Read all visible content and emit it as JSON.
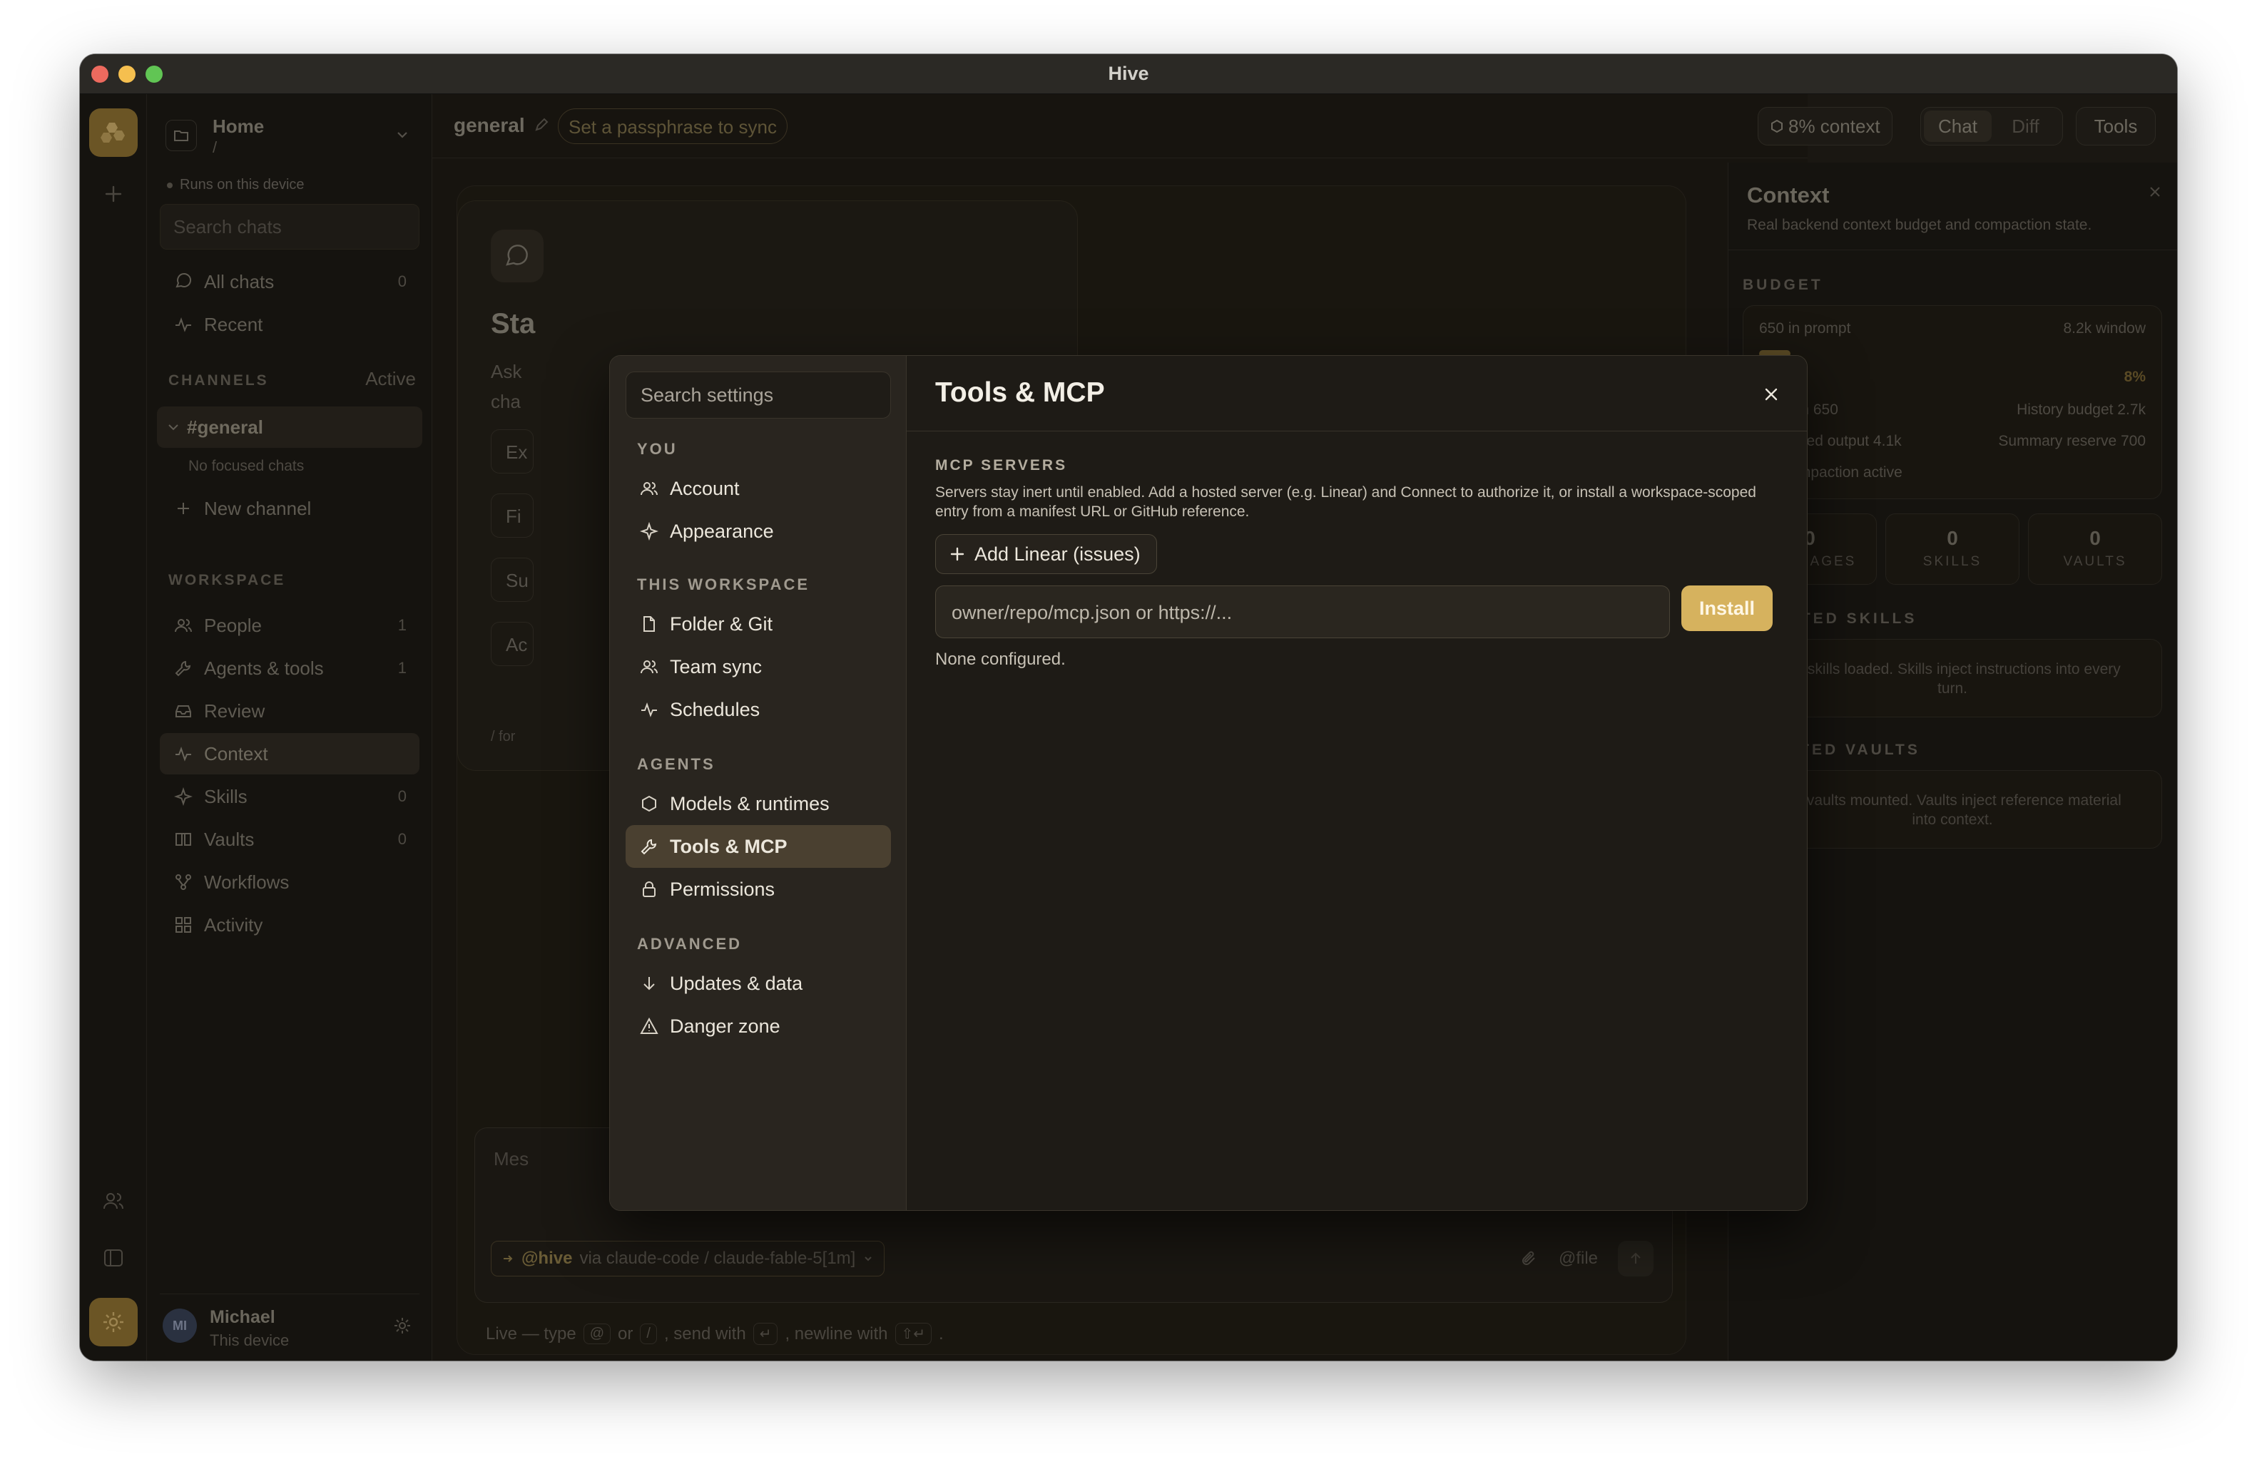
{
  "window": {
    "title": "Hive"
  },
  "sidebar": {
    "workspace_name": "Home",
    "workspace_path": "/",
    "device_note": "Runs on this device",
    "search_placeholder": "Search chats",
    "items_top": [
      {
        "label": "All chats",
        "count": "0",
        "icon": "chat-bubble-icon"
      },
      {
        "label": "Recent",
        "count": "",
        "icon": "activity-icon"
      }
    ],
    "channels_label": "CHANNELS",
    "channels_status": "Active",
    "channel_active": "#general",
    "channel_sub": "No focused chats",
    "new_channel": "New channel",
    "workspace_label": "WORKSPACE",
    "workspace_items": [
      {
        "label": "People",
        "count": "1",
        "icon": "people-icon"
      },
      {
        "label": "Agents & tools",
        "count": "1",
        "icon": "wrench-icon"
      },
      {
        "label": "Review",
        "count": "",
        "icon": "inbox-icon"
      },
      {
        "label": "Context",
        "count": "",
        "icon": "activity-icon"
      },
      {
        "label": "Skills",
        "count": "0",
        "icon": "sparkle-icon"
      },
      {
        "label": "Vaults",
        "count": "0",
        "icon": "book-icon"
      },
      {
        "label": "Workflows",
        "count": "",
        "icon": "workflow-icon"
      },
      {
        "label": "Activity",
        "count": "",
        "icon": "grid-icon"
      }
    ],
    "user": {
      "initials": "MI",
      "name": "Michael",
      "sub": "This device"
    }
  },
  "main": {
    "channel_title": "general",
    "passphrase_pill": "Set a passphrase to sync",
    "context_pill": "8% context",
    "tabs": [
      "Chat",
      "Diff"
    ],
    "tools_button": "Tools",
    "welcome": {
      "title": "Sta",
      "sub": "Ask cha",
      "chips": [
        "Ex",
        "Fi",
        "Su",
        "Ac"
      ],
      "foot": "/ for"
    },
    "composer": {
      "placeholder": "Mes",
      "agent_handle": "@hive",
      "agent_via": "via claude-code / claude-fable-5[1m]",
      "file_label": "@file"
    },
    "live_hint": {
      "prefix": "Live — type",
      "k1": "@",
      "or": "or",
      "k2": "/",
      "send": ", send with",
      "k3": "↵",
      "newline": ", newline with",
      "k4": "⇧↵",
      "end": "."
    }
  },
  "context_panel": {
    "title": "Context",
    "subtitle": "Real backend context budget and compaction state.",
    "budget_label": "BUDGET",
    "in_prompt": "650 in prompt",
    "window": "8.2k window",
    "percent_text": "8%",
    "percent_value": 0.08,
    "system": "System 650",
    "history_budget": "History budget 2.7k",
    "reserved_output": "Reserved output 4.1k",
    "summary_reserve": "Summary reserve 700",
    "compaction": "No compaction active",
    "stats": [
      {
        "num": "0",
        "label": "MESSAGES"
      },
      {
        "num": "0",
        "label": "SKILLS"
      },
      {
        "num": "0",
        "label": "VAULTS"
      }
    ],
    "injected_label": "INJECTED SKILLS",
    "injected_empty": "No skills loaded. Skills inject instructions into every turn.",
    "vaults_label": "MOUNTED VAULTS",
    "vaults_empty": "No vaults mounted. Vaults inject reference material into context."
  },
  "settings": {
    "search_placeholder": "Search settings",
    "sections": [
      {
        "label": "YOU",
        "items": [
          {
            "label": "Account",
            "icon": "account-icon"
          },
          {
            "label": "Appearance",
            "icon": "sparkle-icon"
          }
        ]
      },
      {
        "label": "THIS WORKSPACE",
        "items": [
          {
            "label": "Folder & Git",
            "icon": "file-icon"
          },
          {
            "label": "Team sync",
            "icon": "people-icon"
          },
          {
            "label": "Schedules",
            "icon": "activity-icon"
          }
        ]
      },
      {
        "label": "AGENTS",
        "items": [
          {
            "label": "Models & runtimes",
            "icon": "hexagon-icon"
          },
          {
            "label": "Tools & MCP",
            "icon": "wrench-icon"
          },
          {
            "label": "Permissions",
            "icon": "lock-icon"
          }
        ]
      },
      {
        "label": "ADVANCED",
        "items": [
          {
            "label": "Updates & data",
            "icon": "arrow-down-icon"
          },
          {
            "label": "Danger zone",
            "icon": "warning-icon"
          }
        ]
      }
    ],
    "selected": "Tools & MCP",
    "title": "Tools & MCP",
    "mcp_label": "MCP SERVERS",
    "mcp_description": "Servers stay inert until enabled. Add a hosted server (e.g. Linear) and Connect to authorize it, or install a workspace-scoped entry from a manifest URL or GitHub reference.",
    "add_linear": "Add Linear (issues)",
    "source_placeholder": "owner/repo/mcp.json or https://...",
    "install": "Install",
    "none_configured": "None configured."
  },
  "colors": {
    "accent": "#d6b25e",
    "selected_nav": "#4a4030",
    "modal_bg": "#1e1b16",
    "app_bg": "#15130f"
  }
}
